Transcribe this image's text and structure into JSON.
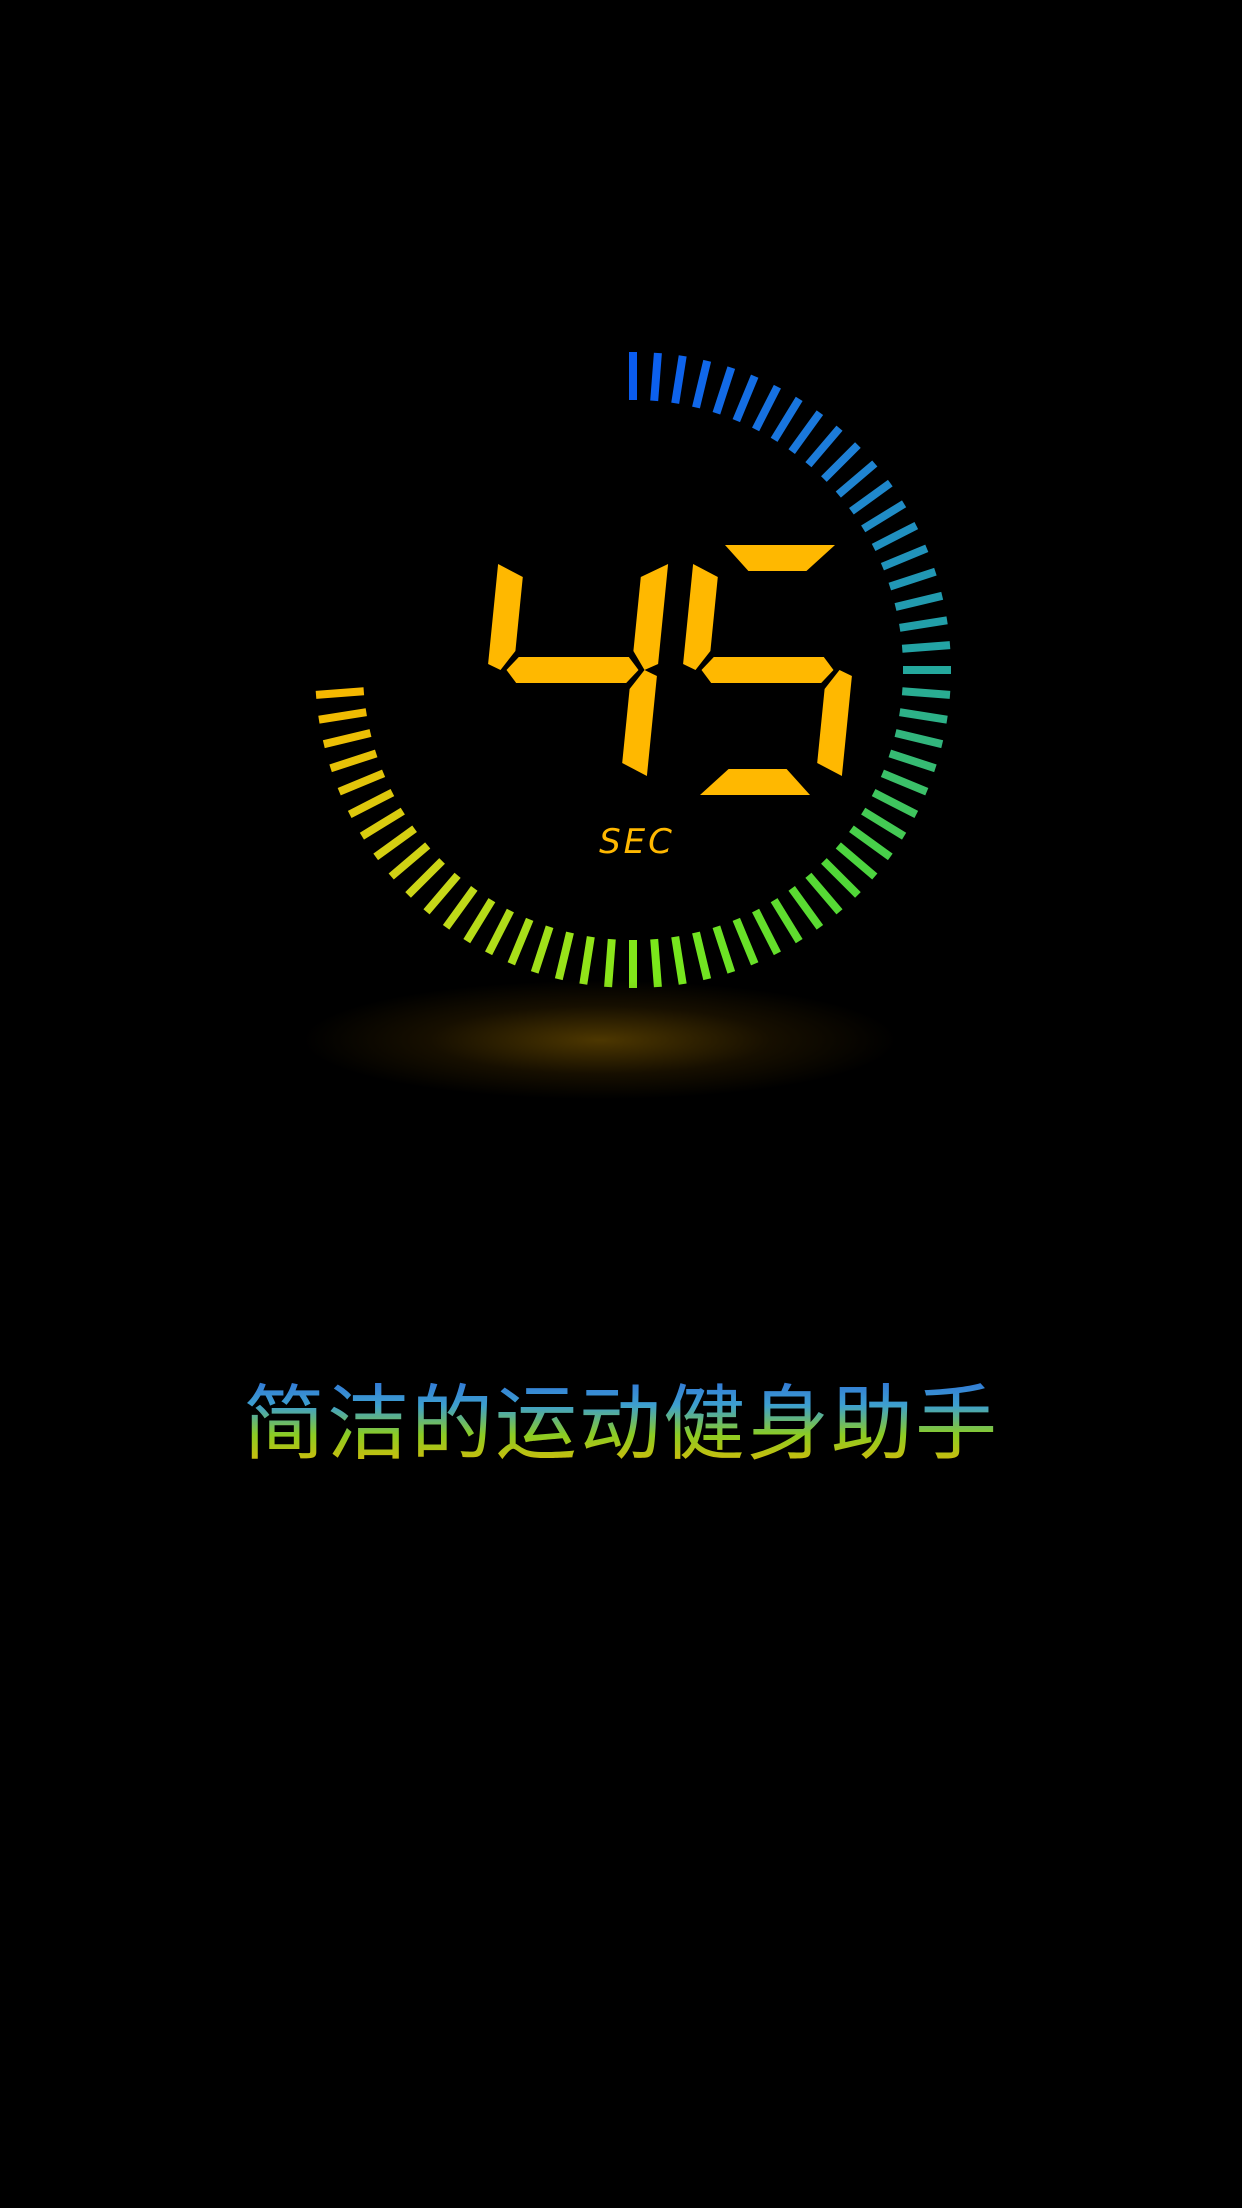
{
  "timer": {
    "value": "45",
    "unit": "SEC",
    "digit_color": "#FFB800",
    "remaining_fraction": 0.75,
    "ring_colors": [
      "#0A5CF0",
      "#1E7FD8",
      "#23A6A0",
      "#4FD63A",
      "#7CE81A",
      "#C8D818",
      "#F5B800"
    ]
  },
  "tagline": {
    "text": "简洁的运动健身助手"
  },
  "background_color": "#000000"
}
